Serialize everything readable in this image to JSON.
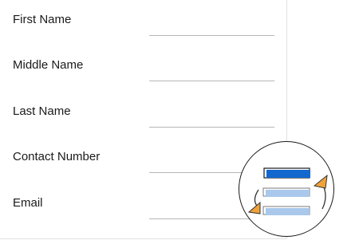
{
  "form": {
    "fields": [
      {
        "label": "First Name",
        "value": ""
      },
      {
        "label": "Middle Name",
        "value": ""
      },
      {
        "label": "Last Name",
        "value": ""
      },
      {
        "label": "Contact Number",
        "value": ""
      },
      {
        "label": "Email",
        "value": ""
      }
    ]
  },
  "reorder_icon": {
    "name": "reorder-list-icon",
    "accent_color": "#1268cf",
    "muted_color": "#a9c8ec",
    "arrow_color": "#f0a23a"
  }
}
